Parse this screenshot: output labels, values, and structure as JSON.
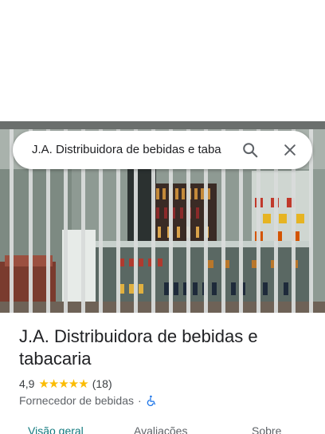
{
  "search": {
    "query": "J.A. Distribuidora de bebidas e taba"
  },
  "place": {
    "name": "J.A. Distribuidora de bebidas e tabacaria",
    "rating": "4,9",
    "stars": "★★★★★",
    "reviews_count": "(18)",
    "category": "Fornecedor de bebidas",
    "separator": "·"
  },
  "tabs": [
    {
      "label": "Visão geral"
    },
    {
      "label": "Avaliações"
    },
    {
      "label": "Sobre"
    }
  ],
  "colors": {
    "accent": "#137a7f",
    "star": "#fbbc04",
    "accessibility": "#1a73e8"
  },
  "icons": [
    "search-icon",
    "close-icon",
    "wheelchair-icon"
  ]
}
